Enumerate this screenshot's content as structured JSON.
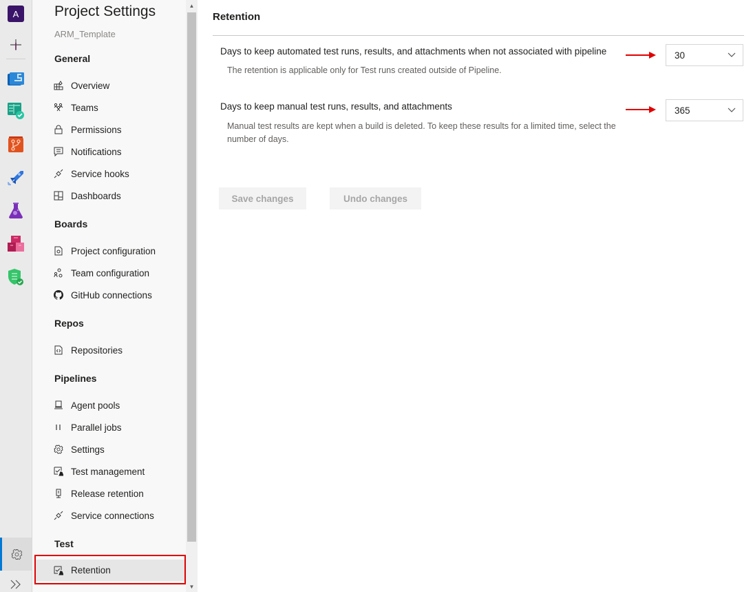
{
  "rail": {
    "org_initial": "A",
    "items": [
      {
        "name": "add",
        "icon": "plus-icon"
      },
      {
        "name": "overview",
        "icon": "overview-icon",
        "color": "#0078d4"
      },
      {
        "name": "boards",
        "icon": "boards-icon",
        "color": "#009a7a"
      },
      {
        "name": "repos",
        "icon": "repos-icon",
        "color": "#e05a1c"
      },
      {
        "name": "pipelines",
        "icon": "pipelines-icon",
        "color": "#2b6fd6"
      },
      {
        "name": "test-plans",
        "icon": "test-plans-icon",
        "color": "#7a2fb8"
      },
      {
        "name": "artifacts",
        "icon": "artifacts-icon",
        "color": "#cc2a64"
      },
      {
        "name": "security",
        "icon": "security-shield-icon",
        "color": "#2eb856"
      }
    ],
    "settings_icon": "gear-icon",
    "expand_icon": "double-chevron-right-icon"
  },
  "nav": {
    "title": "Project Settings",
    "subtitle": "ARM_Template",
    "groups": [
      {
        "label": "General",
        "items": [
          {
            "label": "Overview",
            "icon": "overview-icon"
          },
          {
            "label": "Teams",
            "icon": "teams-icon"
          },
          {
            "label": "Permissions",
            "icon": "lock-icon"
          },
          {
            "label": "Notifications",
            "icon": "chat-icon"
          },
          {
            "label": "Service hooks",
            "icon": "plug-icon"
          },
          {
            "label": "Dashboards",
            "icon": "dashboard-icon"
          }
        ]
      },
      {
        "label": "Boards",
        "items": [
          {
            "label": "Project configuration",
            "icon": "doc-gear-icon"
          },
          {
            "label": "Team configuration",
            "icon": "team-gear-icon"
          },
          {
            "label": "GitHub connections",
            "icon": "github-icon"
          }
        ]
      },
      {
        "label": "Repos",
        "items": [
          {
            "label": "Repositories",
            "icon": "code-file-icon"
          }
        ]
      },
      {
        "label": "Pipelines",
        "items": [
          {
            "label": "Agent pools",
            "icon": "agent-icon"
          },
          {
            "label": "Parallel jobs",
            "icon": "parallel-icon"
          },
          {
            "label": "Settings",
            "icon": "gear-icon"
          },
          {
            "label": "Test management",
            "icon": "test-icon"
          },
          {
            "label": "Release retention",
            "icon": "release-icon"
          },
          {
            "label": "Service connections",
            "icon": "plug-icon"
          }
        ]
      },
      {
        "label": "Test",
        "items": [
          {
            "label": "Retention",
            "icon": "test-icon",
            "selected": true
          }
        ]
      }
    ]
  },
  "main": {
    "title": "Retention",
    "settings": [
      {
        "label": "Days to keep automated test runs, results, and attachments when not associated with pipeline",
        "description": "The retention is applicable only for Test runs created outside of Pipeline.",
        "value": "30"
      },
      {
        "label": "Days to keep manual test runs, results, and attachments",
        "description": "Manual test results are kept when a build is deleted. To keep these results for a limited time, select the number of days.",
        "value": "365"
      }
    ],
    "save_label": "Save changes",
    "undo_label": "Undo changes",
    "annotation_color": "#e00000"
  }
}
